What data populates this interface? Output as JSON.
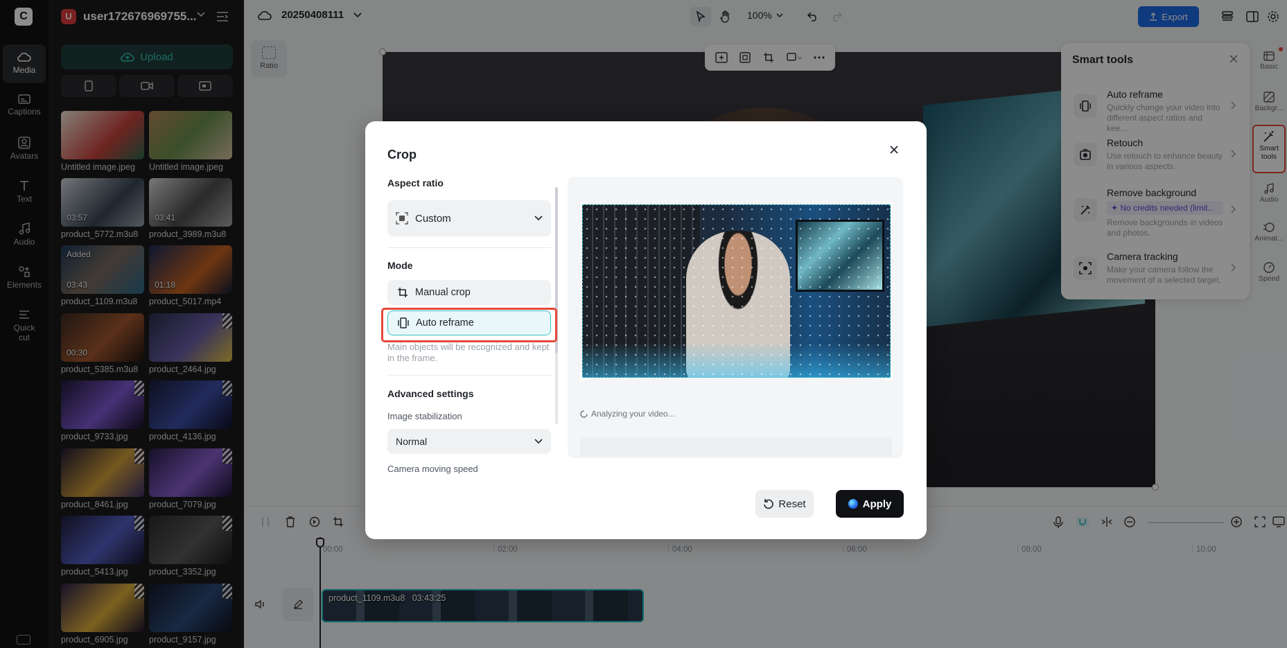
{
  "app": {
    "logo": "capcut-logo"
  },
  "rail": {
    "items": [
      {
        "label": "Media",
        "icon": "cloud-icon"
      },
      {
        "label": "Captions",
        "icon": "captions-icon"
      },
      {
        "label": "Avatars",
        "icon": "avatar-icon"
      },
      {
        "label": "Text",
        "icon": "text-icon"
      },
      {
        "label": "Audio",
        "icon": "music-icon"
      },
      {
        "label": "Elements",
        "icon": "elements-icon"
      },
      {
        "label": "Quick cut",
        "icon": "quick-cut-icon"
      }
    ]
  },
  "media_panel": {
    "user_name": "user172676969755...",
    "user_initial": "U",
    "upload_label": "Upload",
    "thumbnails": [
      {
        "name": "Untitled image.jpeg",
        "duration": "",
        "added": ""
      },
      {
        "name": "Untitled image.jpeg",
        "duration": "",
        "added": ""
      },
      {
        "name": "product_5772.m3u8",
        "duration": "03:57",
        "added": ""
      },
      {
        "name": "product_3989.m3u8",
        "duration": "03:41",
        "added": ""
      },
      {
        "name": "product_1109.m3u8",
        "duration": "03:43",
        "added": "Added"
      },
      {
        "name": "product_5017.mp4",
        "duration": "01:18",
        "added": ""
      },
      {
        "name": "product_5385.m3u8",
        "duration": "00:30",
        "added": ""
      },
      {
        "name": "product_2464.jpg",
        "duration": "",
        "added": ""
      },
      {
        "name": "product_9733.jpg",
        "duration": "",
        "added": ""
      },
      {
        "name": "product_4136.jpg",
        "duration": "",
        "added": ""
      },
      {
        "name": "product_8461.jpg",
        "duration": "",
        "added": ""
      },
      {
        "name": "product_7079.jpg",
        "duration": "",
        "added": ""
      },
      {
        "name": "product_5413.jpg",
        "duration": "",
        "added": ""
      },
      {
        "name": "product_3352.jpg",
        "duration": "",
        "added": ""
      },
      {
        "name": "product_6905.jpg",
        "duration": "",
        "added": ""
      },
      {
        "name": "product_9157.jpg",
        "duration": "",
        "added": ""
      }
    ]
  },
  "topbar": {
    "project_name": "20250408111",
    "zoom": "100%",
    "export_label": "Export"
  },
  "canvas": {
    "ratio_label": "Ratio"
  },
  "smart_tools": {
    "title": "Smart tools",
    "items": [
      {
        "name": "Auto reframe",
        "desc": "Quickly change your video into different aspect ratios and kee...",
        "credit": ""
      },
      {
        "name": "Retouch",
        "desc": "Use retouch to enhance beauty in various aspects.",
        "credit": ""
      },
      {
        "name": "Remove background",
        "desc": "Remove backgrounds in videos and photos.",
        "credit": "✦ No credits needed (limit..."
      },
      {
        "name": "Camera tracking",
        "desc": "Make your camera follow the movement of a selected target.",
        "credit": ""
      }
    ]
  },
  "right_rail": {
    "items": [
      {
        "label": "Basic"
      },
      {
        "label": "Backgr..."
      },
      {
        "label": "Smart tools"
      },
      {
        "label": "Audio"
      },
      {
        "label": "Animat..."
      },
      {
        "label": "Speed"
      }
    ]
  },
  "timeline": {
    "ruler": [
      "00:00",
      "02:00",
      "04:00",
      "06:00",
      "08:00",
      "10:00"
    ],
    "clip_name": "product_1109.m3u8",
    "clip_duration": "03:43:25"
  },
  "crop_modal": {
    "title": "Crop",
    "aspect_ratio_heading": "Aspect ratio",
    "aspect_ratio_value": "Custom",
    "mode_heading": "Mode",
    "manual_crop_label": "Manual crop",
    "auto_reframe_label": "Auto reframe",
    "auto_reframe_hint": "Main objects will be recognized and kept in the frame.",
    "advanced_heading": "Advanced settings",
    "image_stabilization_label": "Image stabilization",
    "image_stabilization_value": "Normal",
    "camera_speed_label": "Camera moving speed",
    "analyzing_text": "Analyzing your video...",
    "reset_label": "Reset",
    "apply_label": "Apply"
  },
  "colors": {
    "accent": "#35c3c8",
    "export": "#1d6ae5",
    "highlight": "#e5483c",
    "apply": "#0f1115"
  }
}
